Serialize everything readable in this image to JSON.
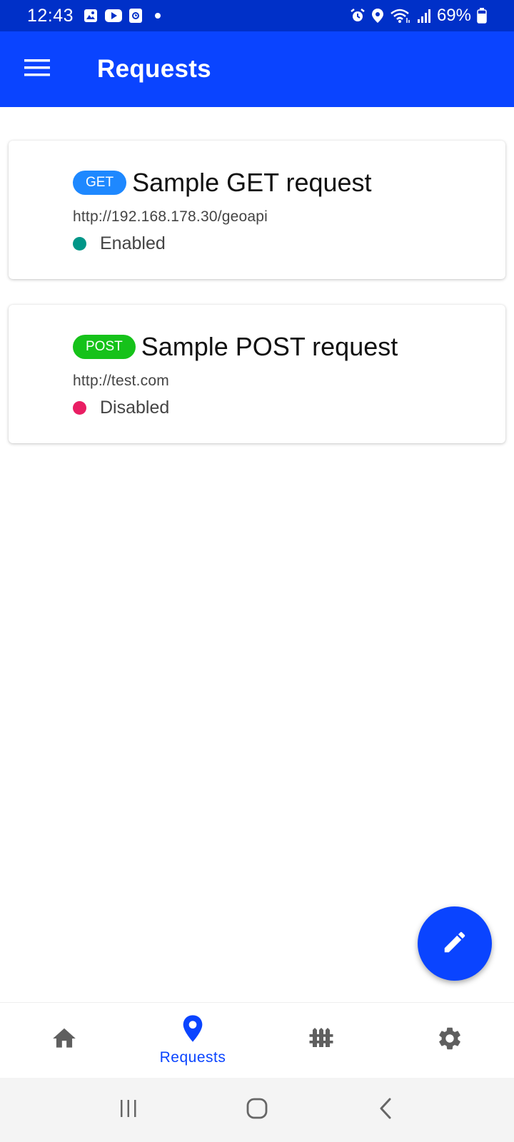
{
  "status_bar": {
    "time": "12:43",
    "battery": "69%",
    "left_icons": [
      "gallery-icon",
      "youtube-icon",
      "screen-record-icon",
      "dot-icon"
    ],
    "right_icons": [
      "alarm-icon",
      "location-icon",
      "wifi-icon",
      "signal-icon",
      "battery-icon"
    ]
  },
  "app_bar": {
    "title": "Requests",
    "menu_icon": "menu-icon"
  },
  "requests": [
    {
      "method": "GET",
      "method_color": "#1e88ff",
      "title": "Sample GET request",
      "url": "http://192.168.178.30/geoapi",
      "status": "Enabled",
      "status_color": "#009688"
    },
    {
      "method": "POST",
      "method_color": "#16c21a",
      "title": "Sample POST request",
      "url": "http://test.com",
      "status": "Disabled",
      "status_color": "#e91e63"
    }
  ],
  "fab": {
    "icon": "edit-icon"
  },
  "bottom_nav": {
    "items": [
      {
        "icon": "home-icon",
        "label": ""
      },
      {
        "icon": "location-pin-icon",
        "label": "Requests",
        "active": true
      },
      {
        "icon": "fence-icon",
        "label": ""
      },
      {
        "icon": "gear-icon",
        "label": ""
      }
    ]
  },
  "system_nav": [
    "recents-icon",
    "home-circle-icon",
    "back-icon"
  ],
  "colors": {
    "status_bar": "#0030c8",
    "primary": "#0a44ff",
    "nav_inactive": "#5f5f5f"
  }
}
